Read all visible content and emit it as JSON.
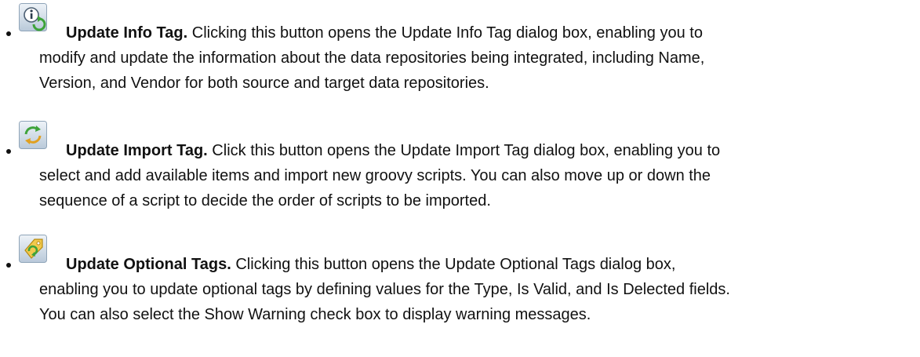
{
  "items": [
    {
      "icon": "info-refresh-icon",
      "term": "Update Info Tag.",
      "lines": [
        " Clicking this button opens the Update Info Tag dialog box, enabling you to",
        "modify and update the information about the data repositories being integrated, including Name,",
        "Version, and Vendor for both source and target data repositories."
      ]
    },
    {
      "icon": "import-refresh-icon",
      "term": "Update Import Tag.",
      "lines": [
        " Click this button opens the Update Import Tag dialog box, enabling you to",
        "select and add available items and import new groovy scripts. You can also move up or down the",
        "sequence of a script to decide the order of scripts to be imported."
      ]
    },
    {
      "icon": "tag-refresh-icon",
      "term": "Update Optional Tags.",
      "lines": [
        " Clicking this button opens the Update Optional Tags dialog box,",
        "enabling you to update optional tags by defining values for the Type, Is Valid, and Is Delected fields.",
        "You can also select the Show Warning check box to display warning messages."
      ]
    }
  ]
}
